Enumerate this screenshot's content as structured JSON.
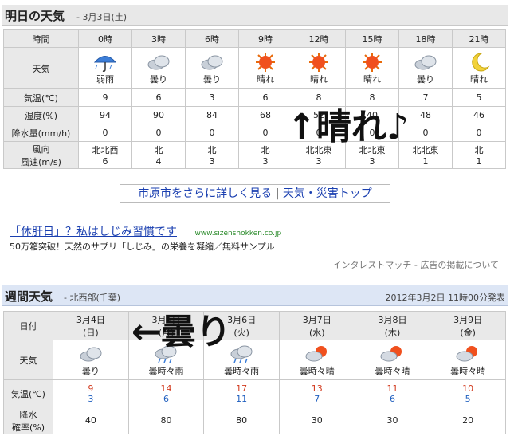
{
  "tomorrow": {
    "title": "明日の天気",
    "date": "- 3月3日(土)",
    "header_label": "時間",
    "times": [
      "0時",
      "3時",
      "6時",
      "9時",
      "12時",
      "15時",
      "18時",
      "21時"
    ],
    "weather_label": "天気",
    "weather": [
      {
        "icon": "umbrella-rain-icon",
        "text": "弱雨"
      },
      {
        "icon": "cloud-icon",
        "text": "曇り"
      },
      {
        "icon": "cloud-icon",
        "text": "曇り"
      },
      {
        "icon": "sun-icon",
        "text": "晴れ"
      },
      {
        "icon": "sun-icon",
        "text": "晴れ"
      },
      {
        "icon": "sun-icon",
        "text": "晴れ"
      },
      {
        "icon": "cloud-icon",
        "text": "曇り"
      },
      {
        "icon": "moon-icon",
        "text": "晴れ"
      }
    ],
    "temp_label": "気温(℃)",
    "temps": [
      "9",
      "6",
      "3",
      "6",
      "8",
      "8",
      "7",
      "5"
    ],
    "humid_label": "湿度(%)",
    "humid": [
      "94",
      "90",
      "84",
      "68",
      "52",
      "40",
      "48",
      "46"
    ],
    "precip_label": "降水量(mm/h)",
    "precip": [
      "0",
      "0",
      "0",
      "0",
      "0",
      "0",
      "0",
      "0"
    ],
    "wind_label1": "風向",
    "wind_label2": "風速(m/s)",
    "wind_dir": [
      "北北西",
      "北",
      "北",
      "北",
      "北北東",
      "北北東",
      "北北東",
      "北"
    ],
    "wind_speed": [
      "6",
      "4",
      "3",
      "3",
      "3",
      "3",
      "1",
      "1"
    ]
  },
  "links": {
    "detail": "市原市をさらに詳しく見る",
    "sep": "|",
    "top": "天気・災害トップ"
  },
  "ad": {
    "headline": "「休肝日」？私はしじみ習慣です",
    "url": "www.sizenshokken.co.jp",
    "desc": "50万箱突破！天然のサプリ「しじみ」の栄養を凝縮／無料サンプル",
    "source": "インタレストマッチ",
    "dash": "-",
    "about": "広告の掲載について"
  },
  "weekly": {
    "title": "週間天気",
    "region": "- 北西部(千葉)",
    "published": "2012年3月2日 11時00分発表",
    "date_label": "日付",
    "days": [
      {
        "date": "3月4日",
        "dow": "(日)",
        "icon": "cloud-icon",
        "text": "曇り",
        "hi": "9",
        "lo": "3",
        "rain": "40"
      },
      {
        "date": "3月5日",
        "dow": "(月)",
        "icon": "cloud-rain-icon",
        "text": "曇時々雨",
        "hi": "14",
        "lo": "6",
        "rain": "80"
      },
      {
        "date": "3月6日",
        "dow": "(火)",
        "icon": "cloud-rain-icon",
        "text": "曇時々雨",
        "hi": "17",
        "lo": "11",
        "rain": "80"
      },
      {
        "date": "3月7日",
        "dow": "(水)",
        "icon": "cloud-sun-icon",
        "text": "曇時々晴",
        "hi": "13",
        "lo": "7",
        "rain": "30"
      },
      {
        "date": "3月8日",
        "dow": "(木)",
        "icon": "cloud-sun-icon",
        "text": "曇時々晴",
        "hi": "11",
        "lo": "6",
        "rain": "30"
      },
      {
        "date": "3月9日",
        "dow": "(金)",
        "icon": "cloud-sun-icon",
        "text": "曇時々晴",
        "hi": "10",
        "lo": "5",
        "rain": "20"
      }
    ],
    "weather_label": "天気",
    "temp_label": "気温(℃)",
    "rain_label1": "降水",
    "rain_label2": "確率(%)"
  },
  "overlay": {
    "sunny": "↑晴れ♪",
    "cloudy": "←曇り"
  },
  "colors": {
    "high": "#d23a1e",
    "low": "#1f5fbf",
    "link": "#1a3fb0",
    "header_bg": "#e8e8e8",
    "weekly_header_bg": "#dde6f5"
  }
}
